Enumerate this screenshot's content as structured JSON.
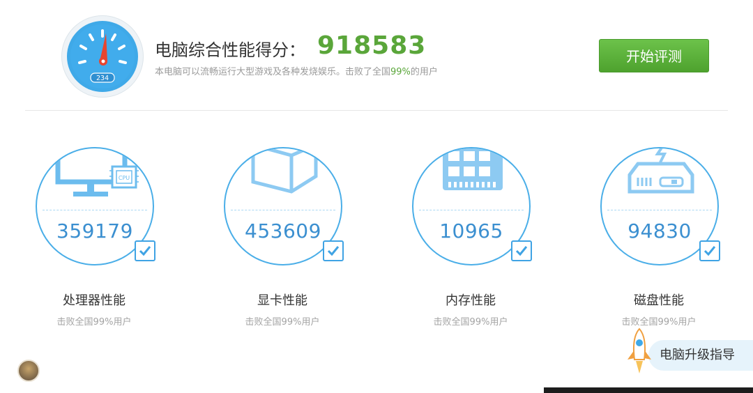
{
  "header": {
    "score_label": "电脑综合性能得分：",
    "score_value": "918583",
    "desc_prefix": "本电脑可以流畅运行大型游戏及各种发烧娱乐。击败了全国",
    "desc_percent": "99%",
    "desc_suffix": "的用户",
    "gauge_readout": "234",
    "start_button": "开始评测"
  },
  "cards": [
    {
      "icon": "monitor-cpu-icon",
      "score": "359179",
      "label": "处理器性能",
      "sub": "击败全国99%用户",
      "cpu_chip": "CPU"
    },
    {
      "icon": "graphics-cube-icon",
      "score": "453609",
      "label": "显卡性能",
      "sub": "击败全国99%用户"
    },
    {
      "icon": "memory-module-icon",
      "score": "10965",
      "label": "内存性能",
      "sub": "击败全国99%用户"
    },
    {
      "icon": "disk-drive-icon",
      "score": "94830",
      "label": "磁盘性能",
      "sub": "击败全国99%用户"
    }
  ],
  "upgrade_button": "电脑升级指导",
  "colors": {
    "accent_blue": "#3fa9e8",
    "score_green": "#5aa63a",
    "button_green": "#5bb43a"
  }
}
